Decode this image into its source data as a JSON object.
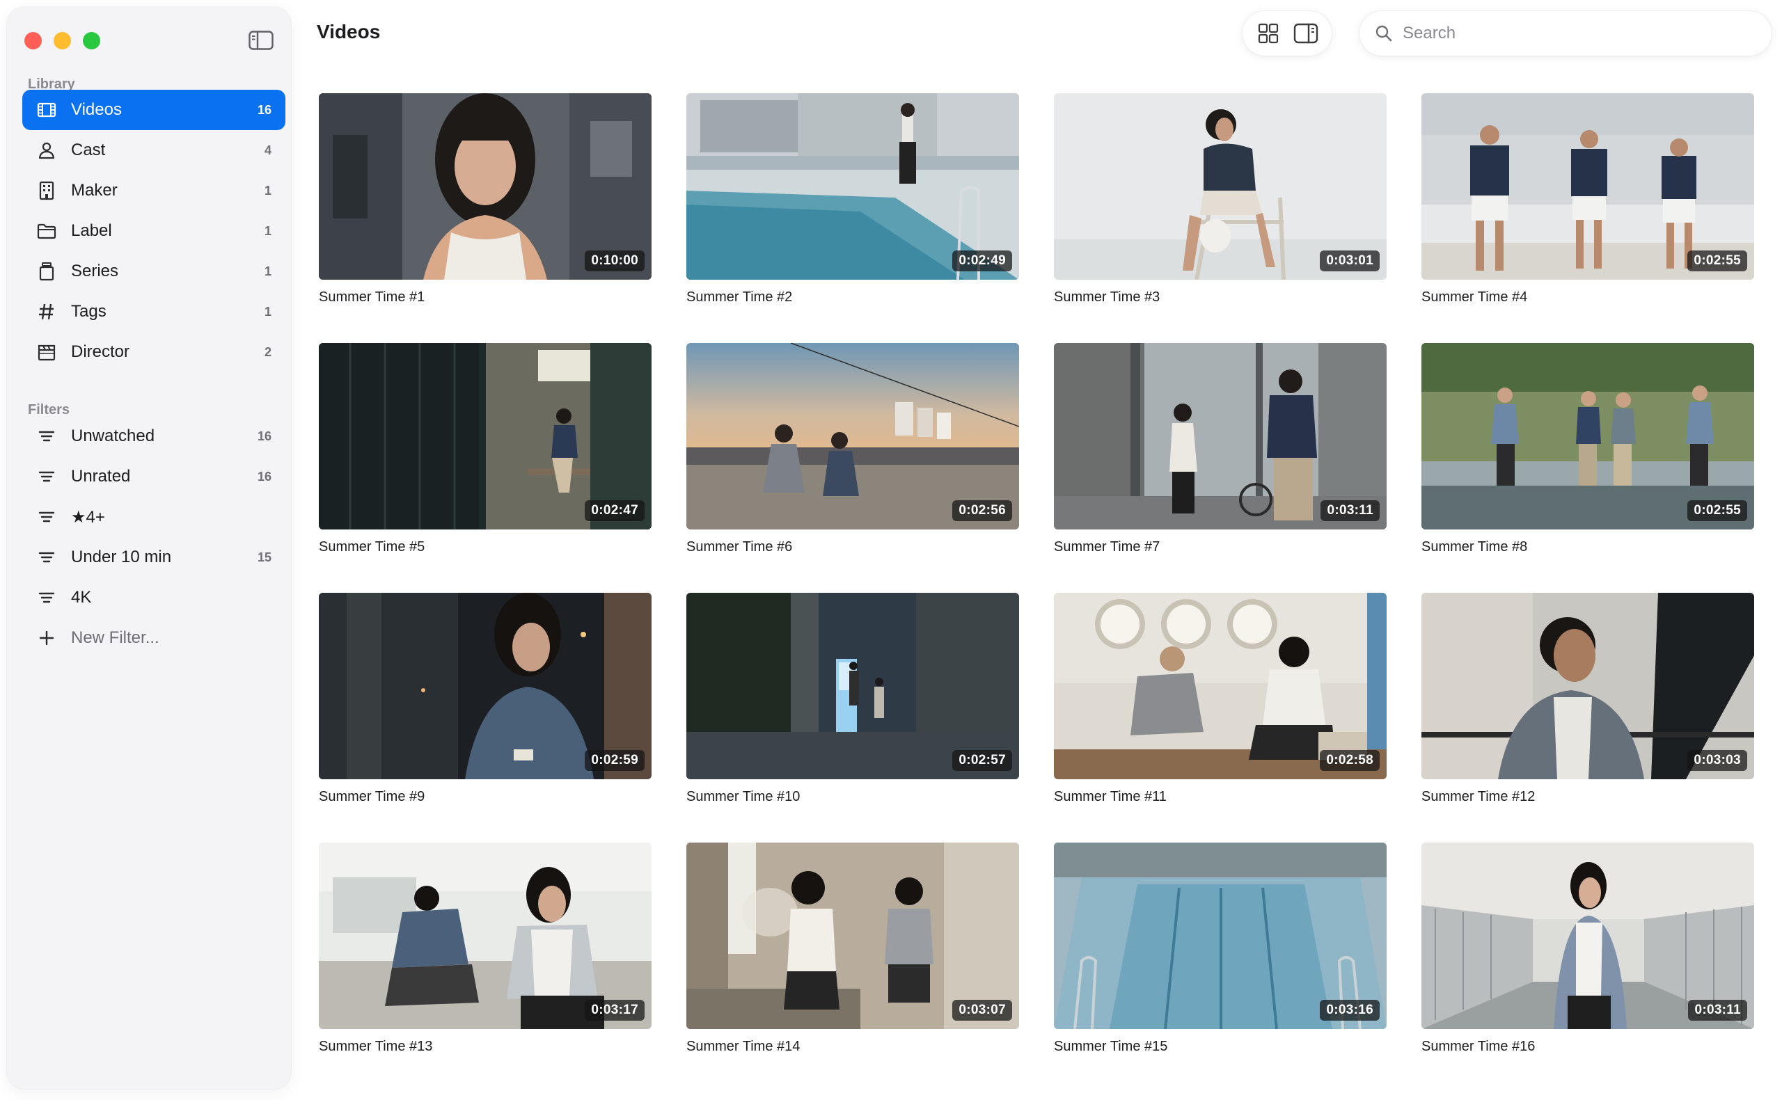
{
  "window": {
    "traffic_lights": [
      "close",
      "minimize",
      "maximize"
    ],
    "colors": {
      "close": "#ff5f57",
      "minimize": "#febc2e",
      "maximize": "#28c840",
      "accent": "#0a72f0"
    }
  },
  "sidebar": {
    "toggle_icon": "sidebar-icon",
    "library_title": "Library",
    "library": [
      {
        "label": "Videos",
        "count": "16",
        "icon": "film-icon",
        "active": true
      },
      {
        "label": "Cast",
        "count": "4",
        "icon": "person-icon"
      },
      {
        "label": "Maker",
        "count": "1",
        "icon": "building-icon"
      },
      {
        "label": "Label",
        "count": "1",
        "icon": "folder-icon"
      },
      {
        "label": "Series",
        "count": "1",
        "icon": "jar-icon"
      },
      {
        "label": "Tags",
        "count": "1",
        "icon": "hashtag-icon"
      },
      {
        "label": "Director",
        "count": "2",
        "icon": "clapperboard-icon"
      }
    ],
    "filters_title": "Filters",
    "filters": [
      {
        "label": "Unwatched",
        "count": "16",
        "icon": "filter-icon"
      },
      {
        "label": "Unrated",
        "count": "16",
        "icon": "filter-icon"
      },
      {
        "label": "★4+",
        "count": "",
        "icon": "filter-icon"
      },
      {
        "label": "Under 10 min",
        "count": "15",
        "icon": "filter-icon"
      },
      {
        "label": "4K",
        "count": "",
        "icon": "filter-icon"
      },
      {
        "label": "New Filter...",
        "count": "",
        "icon": "plus-icon"
      }
    ]
  },
  "header": {
    "title": "Videos",
    "view_grid_icon": "grid-view-icon",
    "view_inspector_icon": "inspector-panel-icon",
    "search_icon": "search-icon",
    "search_placeholder": "Search",
    "search_value": ""
  },
  "videos": [
    {
      "title": "Summer Time #1",
      "duration": "0:10:00"
    },
    {
      "title": "Summer Time #2",
      "duration": "0:02:49"
    },
    {
      "title": "Summer Time #3",
      "duration": "0:03:01"
    },
    {
      "title": "Summer Time #4",
      "duration": "0:02:55"
    },
    {
      "title": "Summer Time #5",
      "duration": "0:02:47"
    },
    {
      "title": "Summer Time #6",
      "duration": "0:02:56"
    },
    {
      "title": "Summer Time #7",
      "duration": "0:03:11"
    },
    {
      "title": "Summer Time #8",
      "duration": "0:02:55"
    },
    {
      "title": "Summer Time #9",
      "duration": "0:02:59"
    },
    {
      "title": "Summer Time #10",
      "duration": "0:02:57"
    },
    {
      "title": "Summer Time #11",
      "duration": "0:02:58"
    },
    {
      "title": "Summer Time #12",
      "duration": "0:03:03"
    },
    {
      "title": "Summer Time #13",
      "duration": "0:03:17"
    },
    {
      "title": "Summer Time #14",
      "duration": "0:03:07"
    },
    {
      "title": "Summer Time #15",
      "duration": "0:03:16"
    },
    {
      "title": "Summer Time #16",
      "duration": "0:03:11"
    }
  ]
}
